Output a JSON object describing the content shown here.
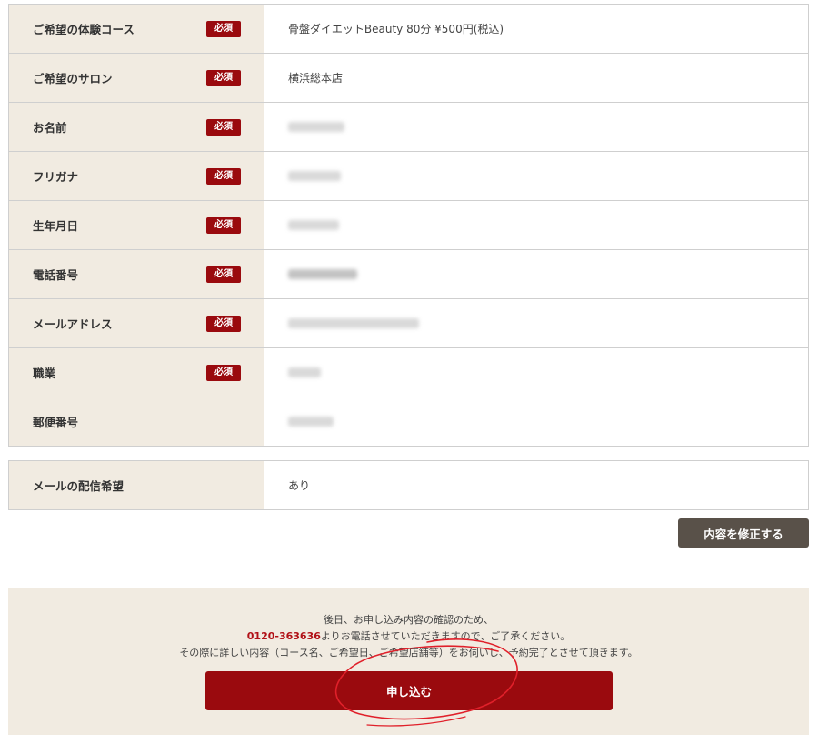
{
  "rows": [
    {
      "label": "ご希望の体験コース",
      "required": true,
      "value": "骨盤ダイエットBeauty 80分 ¥500円(税込)"
    },
    {
      "label": "ご希望のサロン",
      "required": true,
      "value": "横浜総本店"
    },
    {
      "label": "お名前",
      "required": true,
      "value": ""
    },
    {
      "label": "フリガナ",
      "required": true,
      "value": ""
    },
    {
      "label": "生年月日",
      "required": true,
      "value": ""
    },
    {
      "label": "電話番号",
      "required": true,
      "value": ""
    },
    {
      "label": "メールアドレス",
      "required": true,
      "value": ""
    },
    {
      "label": "職業",
      "required": true,
      "value": ""
    },
    {
      "label": "郵便番号",
      "required": false,
      "value": ""
    }
  ],
  "required_badge": "必須",
  "mail_row": {
    "label": "メールの配信希望",
    "value": "あり"
  },
  "edit_button": "内容を修正する",
  "notice": {
    "line1": "後日、お申し込み内容の確認のため、",
    "phone": "0120-363636",
    "line2_rest": "よりお電話させていただきますので、ご了承ください。",
    "line3": "その際に詳しい内容（コース名、ご希望日、ご希望店舗等）をお伺いし、予約完了とさせて頂きます。"
  },
  "submit_button": "申し込む",
  "colors": {
    "label_bg": "#f1ebe1",
    "badge": "#9a0a0e",
    "edit_button": "#595149",
    "submit_button": "#9a0a0e",
    "phone": "#b11117",
    "annotation": "#e0202a"
  }
}
